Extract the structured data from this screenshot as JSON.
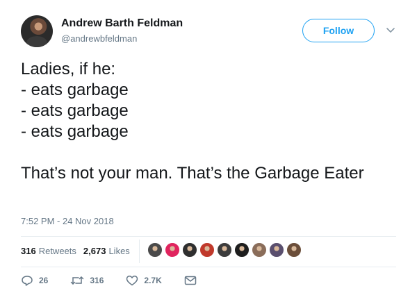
{
  "user": {
    "display_name": "Andrew Barth Feldman",
    "handle": "@andrewbfeldman"
  },
  "follow_label": "Follow",
  "tweet": {
    "lines": [
      "Ladies, if he:",
      "- eats garbage",
      "- eats garbage",
      "- eats garbage"
    ],
    "closing": "That’s not your man. That’s the Garbage Eater"
  },
  "timestamp": "7:52 PM - 24 Nov 2018",
  "stats": {
    "retweets_count": "316",
    "retweets_label": "Retweets",
    "likes_count": "2,673",
    "likes_label": "Likes"
  },
  "liker_avatar_colors": [
    "#4a4a4a",
    "#e0245e",
    "#2f2f2f",
    "#c0392b",
    "#3c3c3c",
    "#1e1e1e",
    "#8a6d5a",
    "#5a4f6e",
    "#6b4e3a"
  ],
  "actions": {
    "replies": "26",
    "retweets": "316",
    "likes": "2.7K"
  },
  "colors": {
    "accent": "#1da1f2",
    "text": "#14171a",
    "muted": "#657786"
  }
}
